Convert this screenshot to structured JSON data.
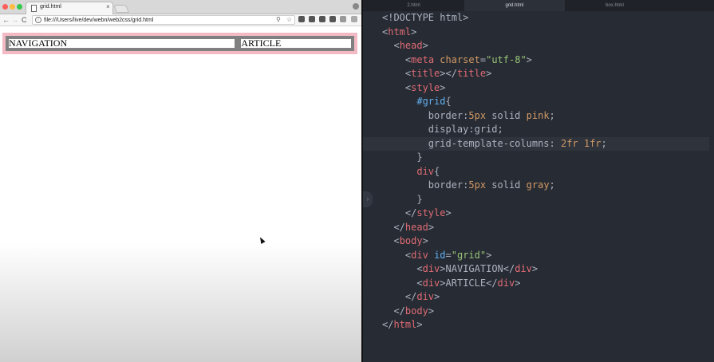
{
  "browser": {
    "tab_title": "grid.html",
    "tab_close": "×",
    "url": "file:///Users/live/dev/webn/web2css/grid.html",
    "nav": {
      "back": "←",
      "forward": "→",
      "reload": "C"
    },
    "zoom_icon": "⚲",
    "star_icon": "☆",
    "page": {
      "nav_text": "NAVIGATION",
      "article_text": "ARTICLE"
    }
  },
  "editor": {
    "tabs": [
      "2.html",
      "grid.html",
      "box.html"
    ],
    "active_tab": "grid.html",
    "lines": {
      "l1": {
        "a": "<!DOCTYPE html>"
      },
      "l2": {
        "a": "<",
        "b": "html",
        "c": ">"
      },
      "l3": {
        "a": "<",
        "b": "head",
        "c": ">"
      },
      "l4": {
        "a": "<",
        "b": "meta",
        "attr": "charset",
        "eq": "=",
        "val": "\"utf-8\"",
        "c": ">"
      },
      "l5": {
        "a": "<",
        "b": "title",
        "c": "></",
        "d": "title",
        "e": ">"
      },
      "l6": {
        "a": "<",
        "b": "style",
        "c": ">"
      },
      "l7": {
        "sel": "#grid",
        "b": "{"
      },
      "l8": {
        "prop": "border:",
        "num": "5px",
        "rest": " solid ",
        "kw": "pink",
        "end": ";"
      },
      "l9": {
        "prop": "display:grid;"
      },
      "l10": {
        "prop": "grid-template-columns: ",
        "num": "2fr 1fr",
        "end": ";"
      },
      "l11": {
        "a": "}"
      },
      "l12": {
        "sel": "div",
        "b": "{"
      },
      "l13": {
        "prop": "border:",
        "num": "5px",
        "rest": " solid ",
        "kw": "gray",
        "end": ";"
      },
      "l14": {
        "a": "}"
      },
      "l15": {
        "a": "</",
        "b": "style",
        "c": ">"
      },
      "l16": {
        "a": "</",
        "b": "head",
        "c": ">"
      },
      "l17": {
        "a": "<",
        "b": "body",
        "c": ">"
      },
      "l18": {
        "a": "<",
        "b": "div",
        "sp": " ",
        "attr": "id",
        "eq": "=",
        "val": "\"grid\"",
        "c": ">"
      },
      "l19": {
        "a": "<",
        "b": "div",
        "c": ">",
        "txt": "NAVIGATION",
        "d": "</",
        "e": "div",
        "f": ">"
      },
      "l20": {
        "a": "<",
        "b": "div",
        "c": ">",
        "txt": "ARTICLE",
        "d": "</",
        "e": "div",
        "f": ">"
      },
      "l21": {
        "a": "</",
        "b": "div",
        "c": ">"
      },
      "l22": {
        "a": "</",
        "b": "body",
        "c": ">"
      },
      "l23": {
        "a": "</",
        "b": "html",
        "c": ">"
      }
    }
  },
  "colors": {
    "editor_bg": "#272b33",
    "tag": "#e06c75",
    "attribute": "#d19a66",
    "string": "#98c379",
    "selector": "#61afef",
    "grid_border": "#f3b9c5",
    "div_border": "#808080"
  },
  "icons": [
    "document-icon",
    "close-icon",
    "back-icon",
    "forward-icon",
    "reload-icon",
    "info-icon",
    "zoom-icon",
    "star-icon",
    "extension-icon",
    "profile-icon",
    "cursor-icon",
    "gutter-chevron-icon"
  ]
}
